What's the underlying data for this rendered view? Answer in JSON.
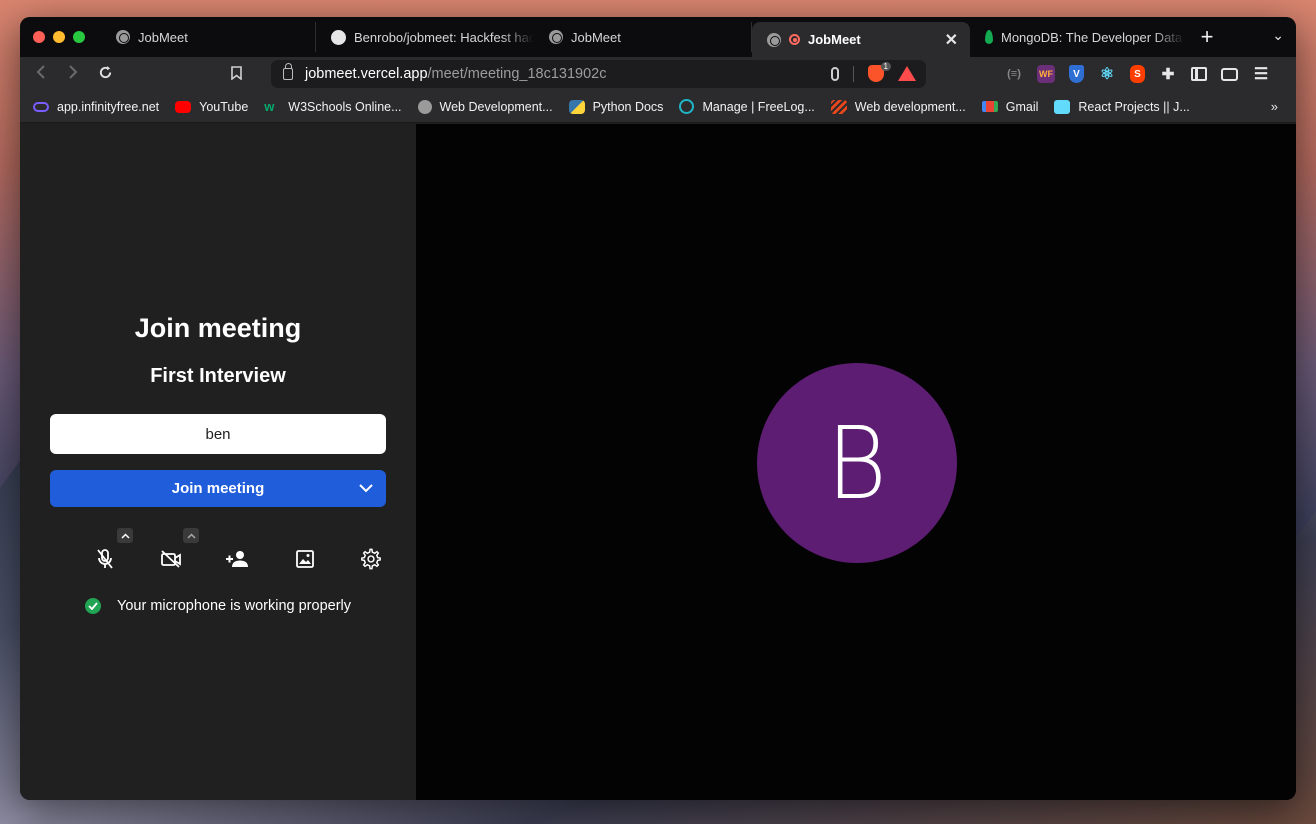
{
  "browser": {
    "tabs": [
      {
        "title": "JobMeet",
        "icon": "globe-icon",
        "active": false
      },
      {
        "title": "Benrobo/jobmeet: Hackfest hac",
        "icon": "github-icon",
        "active": false
      },
      {
        "title": "JobMeet",
        "icon": "globe-icon",
        "active": false
      },
      {
        "title": "JobMeet",
        "icon": "globe-icon",
        "active": true
      },
      {
        "title": "MongoDB: The Developer Data",
        "icon": "mongodb-leaf-icon",
        "active": false
      }
    ],
    "new_tab_symbol": "+",
    "tab_menu_symbol": "⌄",
    "close_symbol": "✕",
    "url_host": "jobmeet.vercel.app",
    "url_path": "/meet/meeting_18c131902c",
    "brave_badge": "1",
    "extensions": [
      {
        "name": "extension-code-icon",
        "label": "(≡)"
      },
      {
        "name": "extension-wf-icon",
        "label": "WF"
      },
      {
        "name": "extension-shield-icon",
        "label": "V"
      },
      {
        "name": "react-devtools-icon",
        "label": "⚛"
      },
      {
        "name": "svelte-devtools-icon",
        "label": "S"
      },
      {
        "name": "extensions-puzzle-icon",
        "label": "✚"
      }
    ],
    "menu_symbol": "☰",
    "bookmarks": [
      {
        "label": "app.infinityfree.net",
        "color": "#7a5cff"
      },
      {
        "label": "YouTube",
        "color": "#ff0000"
      },
      {
        "label": "W3Schools Online...",
        "color": "#04aa6d"
      },
      {
        "label": "Web Development...",
        "color": "#9a9a9a"
      },
      {
        "label": "Python Docs",
        "color": "#3776ab"
      },
      {
        "label": "Manage | FreeLog...",
        "color": "#1fb6c8"
      },
      {
        "label": "Web development...",
        "color": "#e8471c"
      },
      {
        "label": "Gmail",
        "color": "#ea4335"
      },
      {
        "label": "React Projects || J...",
        "color": "#61dafb"
      }
    ],
    "bookmarks_more": "»"
  },
  "meeting": {
    "heading": "Join meeting",
    "name": "First Interview",
    "user_input_value": "ben",
    "join_button_label": "Join meeting",
    "status_text": "Your microphone is working properly",
    "avatar_letter": "B",
    "avatar_color": "#5c1d73",
    "accent_color": "#1f5ddb",
    "status_color": "#21a453"
  }
}
